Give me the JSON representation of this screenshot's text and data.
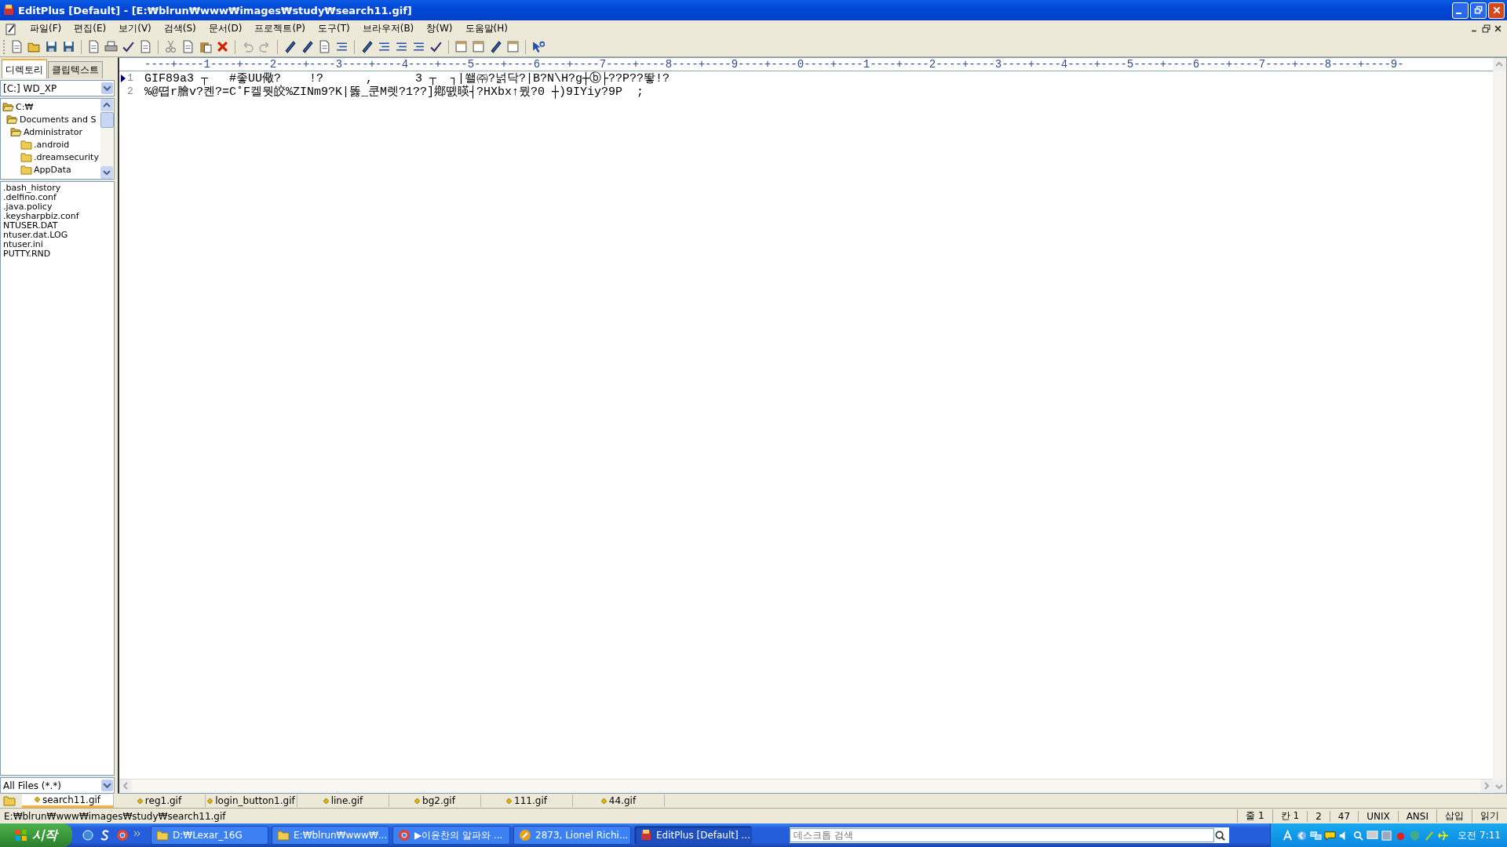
{
  "window": {
    "title": "EditPlus [Default] - [E:₩blrun₩www₩images₩study₩search11.gif]"
  },
  "menu": [
    "파일(F)",
    "편집(E)",
    "보기(V)",
    "검색(S)",
    "문서(D)",
    "프로젝트(P)",
    "도구(T)",
    "브라우저(B)",
    "창(W)",
    "도움말(H)"
  ],
  "sidebar": {
    "tabs": [
      {
        "label": "디렉토리",
        "selected": true
      },
      {
        "label": "클립텍스트",
        "selected": false
      }
    ],
    "drive": "[C:] WD_XP",
    "tree": [
      {
        "label": "C:₩",
        "expanded": true,
        "children": [
          {
            "label": "Documents and S",
            "expanded": true,
            "children": [
              {
                "label": "Administrator",
                "expanded": true,
                "children": [
                  {
                    "label": ".android",
                    "expanded": false
                  },
                  {
                    "label": ".dreamsecurity",
                    "expanded": false
                  },
                  {
                    "label": "AppData",
                    "expanded": false
                  }
                ]
              }
            ]
          }
        ]
      }
    ],
    "files": [
      ".bash_history",
      ".delfino.conf",
      ".java.policy",
      ".keysharpbiz.conf",
      "NTUSER.DAT",
      "ntuser.dat.LOG",
      "ntuser.ini",
      "PUTTY.RND"
    ],
    "filter": "All Files (*.*)"
  },
  "editor": {
    "ruler": "----+----1----+----2----+----3----+----4----+----5----+----6----+----7----+----8----+----9----+----0----+----1----+----2----+----3----+----4----+----5----+----6----+----7----+----8----+----9-",
    "lines": [
      {
        "number": "1",
        "text": "GIF89a3 ┬   #좋UU儆?    !?      ,      3 ┬  ┐|쐘㈜?넑닥?|B?N\\H?g┼ⓑ├??P??뙇!?",
        "current": true
      },
      {
        "number": "2",
        "text": "%@뗩r膾v?켼?=C˚F켈뭣皎%ZINm9?K|똟_쿤M렛?1??]鄕똀暎┤?HXbx↑뭤?0 ┼)9IYiy?9P  ;",
        "current": false
      }
    ]
  },
  "file_tabs": [
    {
      "label": "search11.gif",
      "selected": true
    },
    {
      "label": "reg1.gif",
      "selected": false
    },
    {
      "label": "login_button1.gif",
      "selected": false
    },
    {
      "label": "line.gif",
      "selected": false
    },
    {
      "label": "bg2.gif",
      "selected": false
    },
    {
      "label": "111.gif",
      "selected": false
    },
    {
      "label": "44.gif",
      "selected": false
    }
  ],
  "status_bar": {
    "path": "E:₩blrun₩www₩images₩study₩search11.gif",
    "fields": [
      "줄 1",
      "칸 1",
      "2",
      "47",
      "UNIX",
      "ANSI",
      "삽입",
      "읽기"
    ]
  },
  "taskbar": {
    "start": "시작",
    "tasks": [
      {
        "label": "D:₩Lexar_16G",
        "kind": "folder",
        "selected": false
      },
      {
        "label": "E:₩blrun₩www₩...",
        "kind": "folder",
        "selected": false
      },
      {
        "label": "▶이윤찬의 알파와 ...",
        "kind": "browser",
        "selected": false
      },
      {
        "label": "2873, Lionel Richi...",
        "kind": "music",
        "selected": false
      },
      {
        "label": "EditPlus [Default] ...",
        "kind": "editor",
        "selected": true
      }
    ],
    "search": {
      "placeholder": "데스크톱 검색"
    },
    "clock": "오전 7:11"
  }
}
